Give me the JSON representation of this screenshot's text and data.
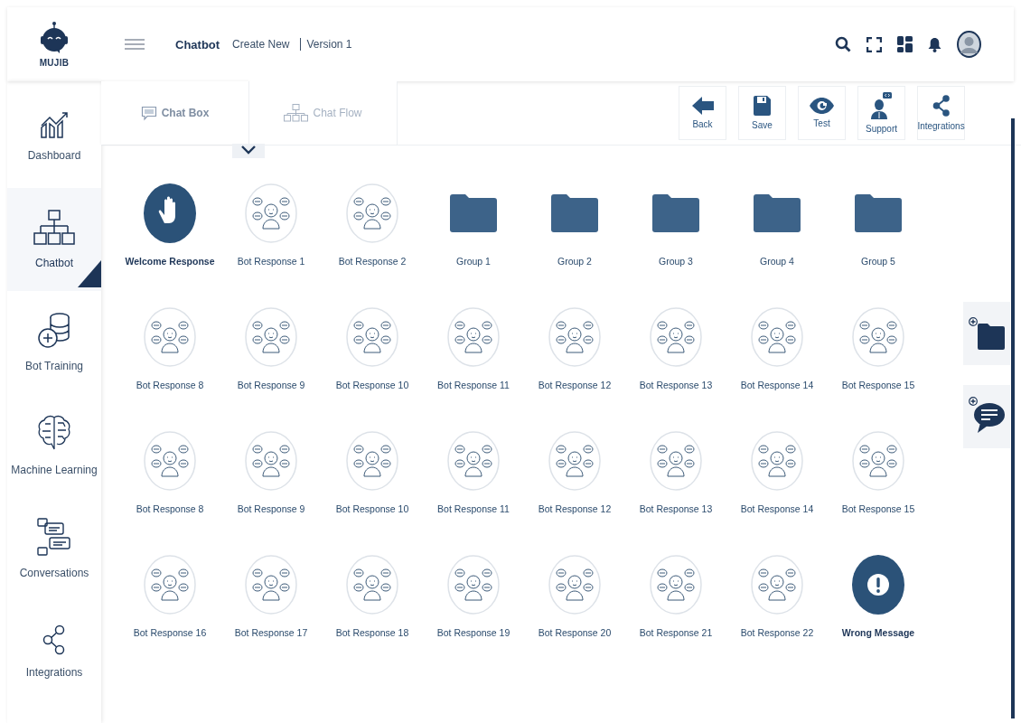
{
  "brand": "MUJIB",
  "breadcrumb": {
    "title": "Chatbot",
    "items": [
      "Create New",
      "Version 1"
    ]
  },
  "sidebar": {
    "items": [
      {
        "kind": "dashboard",
        "label": "Dashboard",
        "selected": false
      },
      {
        "kind": "chatbot",
        "label": "Chatbot",
        "selected": true
      },
      {
        "kind": "training",
        "label": "Bot Training",
        "selected": false
      },
      {
        "kind": "ml",
        "label": "Machine Learning",
        "selected": false
      },
      {
        "kind": "conversations",
        "label": "Conversations",
        "selected": false
      },
      {
        "kind": "integrations",
        "label": "Integrations",
        "selected": false
      }
    ]
  },
  "tabs": [
    {
      "kind": "chat",
      "label": "Chat Box",
      "selected": true
    },
    {
      "kind": "flow",
      "label": "Chat Flow",
      "selected": false
    }
  ],
  "toolbar": [
    {
      "kind": "back",
      "label": "Back"
    },
    {
      "kind": "save",
      "label": "Save"
    },
    {
      "kind": "test",
      "label": "Test"
    },
    {
      "kind": "support",
      "label": "Support"
    },
    {
      "kind": "integrations",
      "label": "Integrations"
    }
  ],
  "nodes": [
    {
      "kind": "welcome",
      "label": "Welcome Response"
    },
    {
      "kind": "bot",
      "label": "Bot Response 1"
    },
    {
      "kind": "bot",
      "label": "Bot Response 2"
    },
    {
      "kind": "group",
      "label": "Group 1"
    },
    {
      "kind": "group",
      "label": "Group 2"
    },
    {
      "kind": "group",
      "label": "Group 3"
    },
    {
      "kind": "group",
      "label": "Group 4"
    },
    {
      "kind": "group",
      "label": "Group 5"
    },
    {
      "kind": "bot",
      "label": "Bot Response 8"
    },
    {
      "kind": "bot",
      "label": "Bot Response 9"
    },
    {
      "kind": "bot",
      "label": "Bot Response 10"
    },
    {
      "kind": "bot",
      "label": "Bot Response 11"
    },
    {
      "kind": "bot",
      "label": "Bot Response 12"
    },
    {
      "kind": "bot",
      "label": "Bot Response 13"
    },
    {
      "kind": "bot",
      "label": "Bot Response 14"
    },
    {
      "kind": "bot",
      "label": "Bot Response 15"
    },
    {
      "kind": "bot",
      "label": "Bot Response 8"
    },
    {
      "kind": "bot",
      "label": "Bot Response 9"
    },
    {
      "kind": "bot",
      "label": "Bot Response 10"
    },
    {
      "kind": "bot",
      "label": "Bot Response 11"
    },
    {
      "kind": "bot",
      "label": "Bot Response 12"
    },
    {
      "kind": "bot",
      "label": "Bot Response 13"
    },
    {
      "kind": "bot",
      "label": "Bot Response 14"
    },
    {
      "kind": "bot",
      "label": "Bot Response 15"
    },
    {
      "kind": "bot",
      "label": "Bot Response 16"
    },
    {
      "kind": "bot",
      "label": "Bot Response 17"
    },
    {
      "kind": "bot",
      "label": "Bot Response 18"
    },
    {
      "kind": "bot",
      "label": "Bot Response 19"
    },
    {
      "kind": "bot",
      "label": "Bot Response 20"
    },
    {
      "kind": "bot",
      "label": "Bot Response 21"
    },
    {
      "kind": "bot",
      "label": "Bot Response 22"
    },
    {
      "kind": "error",
      "label": "Wrong Message"
    }
  ]
}
